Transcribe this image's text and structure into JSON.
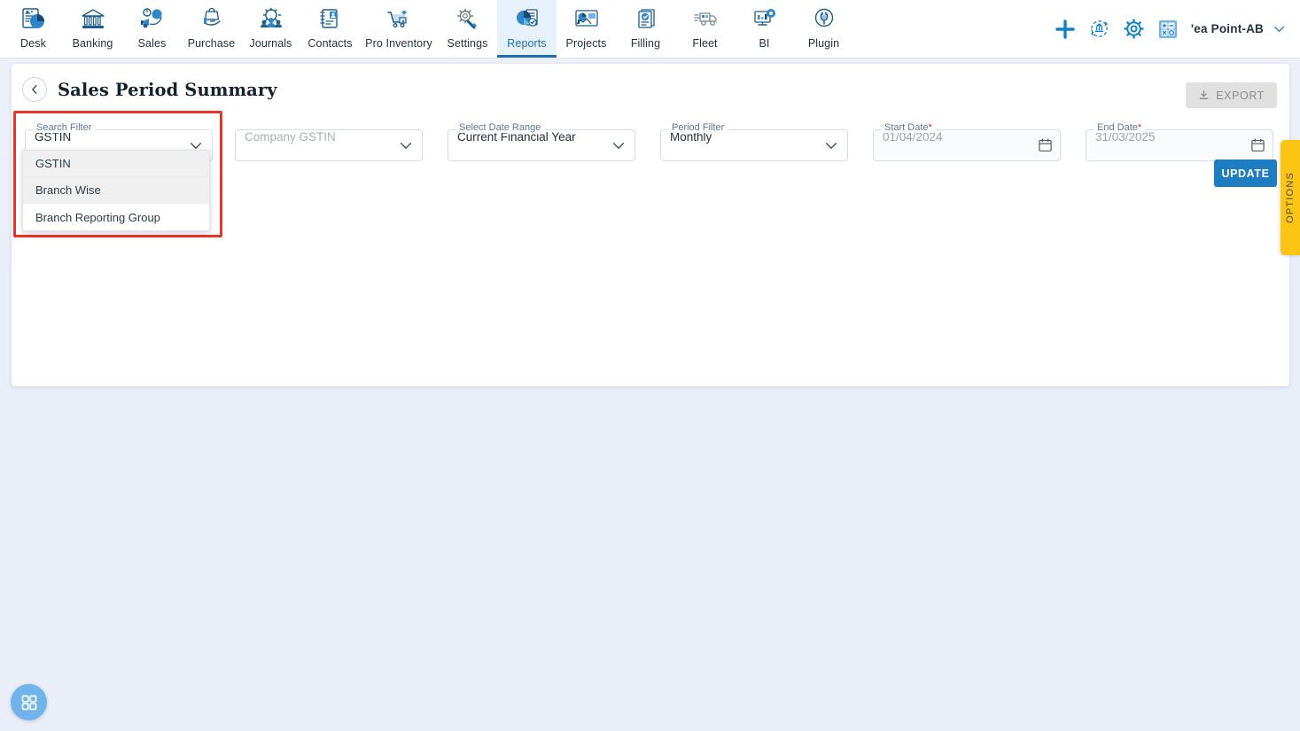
{
  "nav": {
    "items": [
      {
        "label": "Desk",
        "icon": "desk-chart-icon",
        "active": false
      },
      {
        "label": "Banking",
        "icon": "bank-icon",
        "active": false
      },
      {
        "label": "Sales",
        "icon": "sales-megaphone-icon",
        "active": false
      },
      {
        "label": "Purchase",
        "icon": "purchase-hand-bag-icon",
        "active": false
      },
      {
        "label": "Journals",
        "icon": "journals-gear-people-icon",
        "active": false
      },
      {
        "label": "Contacts",
        "icon": "contacts-book-icon",
        "active": false
      },
      {
        "label": "Pro Inventory",
        "icon": "inventory-cart-icon",
        "active": false
      },
      {
        "label": "Settings",
        "icon": "settings-tools-icon",
        "active": false
      },
      {
        "label": "Reports",
        "icon": "reports-pie-doc-icon",
        "active": true
      },
      {
        "label": "Projects",
        "icon": "projects-board-icon",
        "active": false
      },
      {
        "label": "Filling",
        "icon": "filling-docs-icon",
        "active": false
      },
      {
        "label": "Fleet",
        "icon": "fleet-truck-icon",
        "active": false
      },
      {
        "label": "BI",
        "icon": "bi-monitor-icon",
        "active": false
      },
      {
        "label": "Plugin",
        "icon": "plugin-plug-icon",
        "active": false
      }
    ],
    "right": {
      "add_icon": "plus-icon",
      "bank_sync_icon": "bank-refresh-icon",
      "settings_icon": "gear-icon",
      "calculator_icon": "calculator-icon",
      "company_name": "'ea Point-AB",
      "company_chevron_icon": "chevron-down-icon"
    }
  },
  "page": {
    "back_icon": "chevron-left-icon",
    "title": "Sales Period Summary",
    "export_label": "EXPORT",
    "export_icon": "download-icon",
    "update_label": "UPDATE"
  },
  "filters": {
    "search_filter": {
      "label": "Search Filter",
      "value": "GSTIN",
      "chevron_icon": "chevron-down-icon",
      "options": [
        {
          "label": "GSTIN",
          "highlighted": true
        },
        {
          "label": "Branch Wise",
          "highlighted": true
        },
        {
          "label": "Branch Reporting Group",
          "highlighted": false
        }
      ]
    },
    "company_gstin": {
      "placeholder": "Company GSTIN",
      "value": "",
      "chevron_icon": "chevron-down-icon"
    },
    "date_range": {
      "label": "Select Date Range",
      "value": "Current Financial Year",
      "chevron_icon": "chevron-down-icon"
    },
    "period_filter": {
      "label": "Period Filter",
      "value": "Monthly",
      "chevron_icon": "chevron-down-icon"
    },
    "start_date": {
      "label": "Start Date",
      "required_mark": "*",
      "value": "01/04/2024",
      "calendar_icon": "calendar-icon"
    },
    "end_date": {
      "label": "End Date",
      "required_mark": "*",
      "value": "31/03/2025",
      "calendar_icon": "calendar-icon"
    }
  },
  "options_tab": {
    "label": "OPTIONS"
  },
  "fab": {
    "icon": "apps-grid-icon"
  },
  "colors": {
    "accent_blue": "#1e7cc0",
    "active_tab_bg": "#e7f1fb",
    "highlight_red": "#e8342a",
    "options_yellow": "#fcc413",
    "page_bg": "#e9eef9",
    "fab_blue": "#6fb3ea"
  }
}
